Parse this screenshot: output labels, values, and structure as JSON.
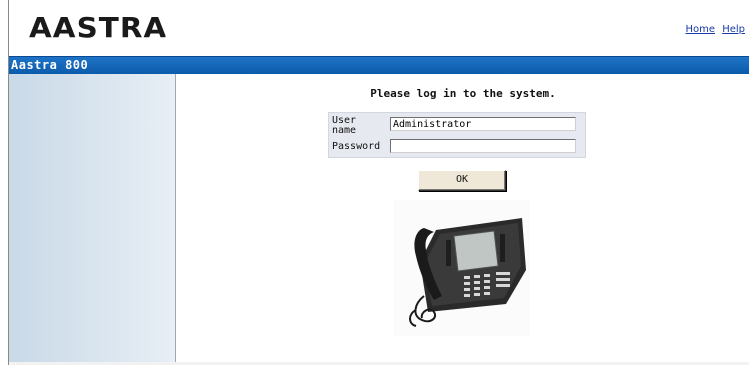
{
  "header": {
    "logo": "AASTRA",
    "links": [
      "Home",
      "Help"
    ]
  },
  "bar": {
    "title": "Aastra 800"
  },
  "login": {
    "title": "Please log in to the system.",
    "user_label": "User name",
    "user_value": "Administrator",
    "password_label": "Password",
    "password_value": "",
    "ok_label": "OK"
  },
  "icons": {
    "phone": "desk-phone-image"
  },
  "colors": {
    "bar": "#0b5aaa",
    "sidebar": "#d6e2ec",
    "form_box": "#e6e9f0",
    "button": "#efe8d8"
  }
}
